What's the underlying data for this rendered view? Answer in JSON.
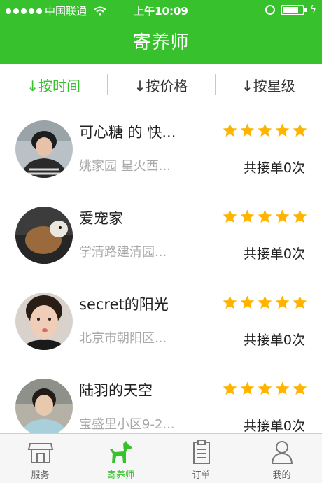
{
  "status_bar": {
    "carrier": "中国联通",
    "time": "上午10:09",
    "battery_level": 0.8
  },
  "header": {
    "title": "寄养师"
  },
  "sort_bar": {
    "items": [
      {
        "label": "↓按时间",
        "active": true
      },
      {
        "label": "↓按价格",
        "active": false
      },
      {
        "label": "↓按星级",
        "active": false
      }
    ]
  },
  "sitters": [
    {
      "name": "可心糖 的 快...",
      "address": "姚家园 星火西...",
      "rating": 5,
      "orders": "共接单0次"
    },
    {
      "name": "爱宠家",
      "address": "学清路建清园...",
      "rating": 5,
      "orders": "共接单0次"
    },
    {
      "name": "secret的阳光",
      "address": "北京市朝阳区...",
      "rating": 5,
      "orders": "共接单0次"
    },
    {
      "name": "陆羽的天空",
      "address": "宝盛里小区9-2...",
      "rating": 5,
      "orders": "共接单0次"
    }
  ],
  "tab_bar": {
    "items": [
      {
        "label": "服务",
        "icon": "store-icon",
        "active": false
      },
      {
        "label": "寄养师",
        "icon": "dog-icon",
        "active": true
      },
      {
        "label": "订单",
        "icon": "clipboard-icon",
        "active": false
      },
      {
        "label": "我的",
        "icon": "person-icon",
        "active": false
      }
    ]
  },
  "colors": {
    "brand_green": "#37c22d",
    "star": "#ffb400"
  }
}
